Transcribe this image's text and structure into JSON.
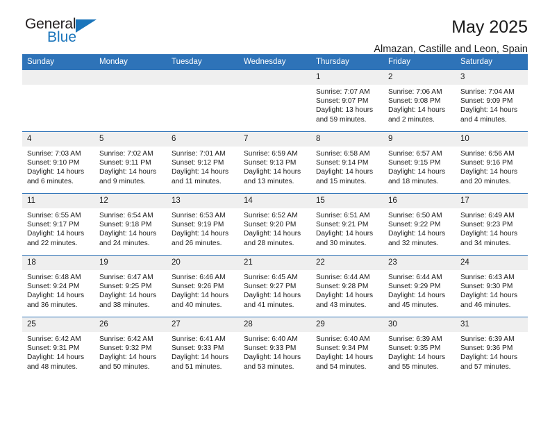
{
  "brand": {
    "name_part1": "General",
    "name_part2": "Blue",
    "flag_color": "#1b75bb"
  },
  "header": {
    "title": "May 2025",
    "subtitle": "Almazan, Castille and Leon, Spain",
    "header_bg_color": "#2e73b8",
    "daynum_bg_color": "#efefef"
  },
  "weekdays": [
    "Sunday",
    "Monday",
    "Tuesday",
    "Wednesday",
    "Thursday",
    "Friday",
    "Saturday"
  ],
  "weeks": [
    [
      {
        "day": "",
        "sunrise": "",
        "sunset": "",
        "daylight": "",
        "empty": true
      },
      {
        "day": "",
        "sunrise": "",
        "sunset": "",
        "daylight": "",
        "empty": true
      },
      {
        "day": "",
        "sunrise": "",
        "sunset": "",
        "daylight": "",
        "empty": true
      },
      {
        "day": "",
        "sunrise": "",
        "sunset": "",
        "daylight": "",
        "empty": true
      },
      {
        "day": "1",
        "sunrise": "Sunrise: 7:07 AM",
        "sunset": "Sunset: 9:07 PM",
        "daylight": "Daylight: 13 hours and 59 minutes.",
        "empty": false
      },
      {
        "day": "2",
        "sunrise": "Sunrise: 7:06 AM",
        "sunset": "Sunset: 9:08 PM",
        "daylight": "Daylight: 14 hours and 2 minutes.",
        "empty": false
      },
      {
        "day": "3",
        "sunrise": "Sunrise: 7:04 AM",
        "sunset": "Sunset: 9:09 PM",
        "daylight": "Daylight: 14 hours and 4 minutes.",
        "empty": false
      }
    ],
    [
      {
        "day": "4",
        "sunrise": "Sunrise: 7:03 AM",
        "sunset": "Sunset: 9:10 PM",
        "daylight": "Daylight: 14 hours and 6 minutes.",
        "empty": false
      },
      {
        "day": "5",
        "sunrise": "Sunrise: 7:02 AM",
        "sunset": "Sunset: 9:11 PM",
        "daylight": "Daylight: 14 hours and 9 minutes.",
        "empty": false
      },
      {
        "day": "6",
        "sunrise": "Sunrise: 7:01 AM",
        "sunset": "Sunset: 9:12 PM",
        "daylight": "Daylight: 14 hours and 11 minutes.",
        "empty": false
      },
      {
        "day": "7",
        "sunrise": "Sunrise: 6:59 AM",
        "sunset": "Sunset: 9:13 PM",
        "daylight": "Daylight: 14 hours and 13 minutes.",
        "empty": false
      },
      {
        "day": "8",
        "sunrise": "Sunrise: 6:58 AM",
        "sunset": "Sunset: 9:14 PM",
        "daylight": "Daylight: 14 hours and 15 minutes.",
        "empty": false
      },
      {
        "day": "9",
        "sunrise": "Sunrise: 6:57 AM",
        "sunset": "Sunset: 9:15 PM",
        "daylight": "Daylight: 14 hours and 18 minutes.",
        "empty": false
      },
      {
        "day": "10",
        "sunrise": "Sunrise: 6:56 AM",
        "sunset": "Sunset: 9:16 PM",
        "daylight": "Daylight: 14 hours and 20 minutes.",
        "empty": false
      }
    ],
    [
      {
        "day": "11",
        "sunrise": "Sunrise: 6:55 AM",
        "sunset": "Sunset: 9:17 PM",
        "daylight": "Daylight: 14 hours and 22 minutes.",
        "empty": false
      },
      {
        "day": "12",
        "sunrise": "Sunrise: 6:54 AM",
        "sunset": "Sunset: 9:18 PM",
        "daylight": "Daylight: 14 hours and 24 minutes.",
        "empty": false
      },
      {
        "day": "13",
        "sunrise": "Sunrise: 6:53 AM",
        "sunset": "Sunset: 9:19 PM",
        "daylight": "Daylight: 14 hours and 26 minutes.",
        "empty": false
      },
      {
        "day": "14",
        "sunrise": "Sunrise: 6:52 AM",
        "sunset": "Sunset: 9:20 PM",
        "daylight": "Daylight: 14 hours and 28 minutes.",
        "empty": false
      },
      {
        "day": "15",
        "sunrise": "Sunrise: 6:51 AM",
        "sunset": "Sunset: 9:21 PM",
        "daylight": "Daylight: 14 hours and 30 minutes.",
        "empty": false
      },
      {
        "day": "16",
        "sunrise": "Sunrise: 6:50 AM",
        "sunset": "Sunset: 9:22 PM",
        "daylight": "Daylight: 14 hours and 32 minutes.",
        "empty": false
      },
      {
        "day": "17",
        "sunrise": "Sunrise: 6:49 AM",
        "sunset": "Sunset: 9:23 PM",
        "daylight": "Daylight: 14 hours and 34 minutes.",
        "empty": false
      }
    ],
    [
      {
        "day": "18",
        "sunrise": "Sunrise: 6:48 AM",
        "sunset": "Sunset: 9:24 PM",
        "daylight": "Daylight: 14 hours and 36 minutes.",
        "empty": false
      },
      {
        "day": "19",
        "sunrise": "Sunrise: 6:47 AM",
        "sunset": "Sunset: 9:25 PM",
        "daylight": "Daylight: 14 hours and 38 minutes.",
        "empty": false
      },
      {
        "day": "20",
        "sunrise": "Sunrise: 6:46 AM",
        "sunset": "Sunset: 9:26 PM",
        "daylight": "Daylight: 14 hours and 40 minutes.",
        "empty": false
      },
      {
        "day": "21",
        "sunrise": "Sunrise: 6:45 AM",
        "sunset": "Sunset: 9:27 PM",
        "daylight": "Daylight: 14 hours and 41 minutes.",
        "empty": false
      },
      {
        "day": "22",
        "sunrise": "Sunrise: 6:44 AM",
        "sunset": "Sunset: 9:28 PM",
        "daylight": "Daylight: 14 hours and 43 minutes.",
        "empty": false
      },
      {
        "day": "23",
        "sunrise": "Sunrise: 6:44 AM",
        "sunset": "Sunset: 9:29 PM",
        "daylight": "Daylight: 14 hours and 45 minutes.",
        "empty": false
      },
      {
        "day": "24",
        "sunrise": "Sunrise: 6:43 AM",
        "sunset": "Sunset: 9:30 PM",
        "daylight": "Daylight: 14 hours and 46 minutes.",
        "empty": false
      }
    ],
    [
      {
        "day": "25",
        "sunrise": "Sunrise: 6:42 AM",
        "sunset": "Sunset: 9:31 PM",
        "daylight": "Daylight: 14 hours and 48 minutes.",
        "empty": false
      },
      {
        "day": "26",
        "sunrise": "Sunrise: 6:42 AM",
        "sunset": "Sunset: 9:32 PM",
        "daylight": "Daylight: 14 hours and 50 minutes.",
        "empty": false
      },
      {
        "day": "27",
        "sunrise": "Sunrise: 6:41 AM",
        "sunset": "Sunset: 9:33 PM",
        "daylight": "Daylight: 14 hours and 51 minutes.",
        "empty": false
      },
      {
        "day": "28",
        "sunrise": "Sunrise: 6:40 AM",
        "sunset": "Sunset: 9:33 PM",
        "daylight": "Daylight: 14 hours and 53 minutes.",
        "empty": false
      },
      {
        "day": "29",
        "sunrise": "Sunrise: 6:40 AM",
        "sunset": "Sunset: 9:34 PM",
        "daylight": "Daylight: 14 hours and 54 minutes.",
        "empty": false
      },
      {
        "day": "30",
        "sunrise": "Sunrise: 6:39 AM",
        "sunset": "Sunset: 9:35 PM",
        "daylight": "Daylight: 14 hours and 55 minutes.",
        "empty": false
      },
      {
        "day": "31",
        "sunrise": "Sunrise: 6:39 AM",
        "sunset": "Sunset: 9:36 PM",
        "daylight": "Daylight: 14 hours and 57 minutes.",
        "empty": false
      }
    ]
  ]
}
